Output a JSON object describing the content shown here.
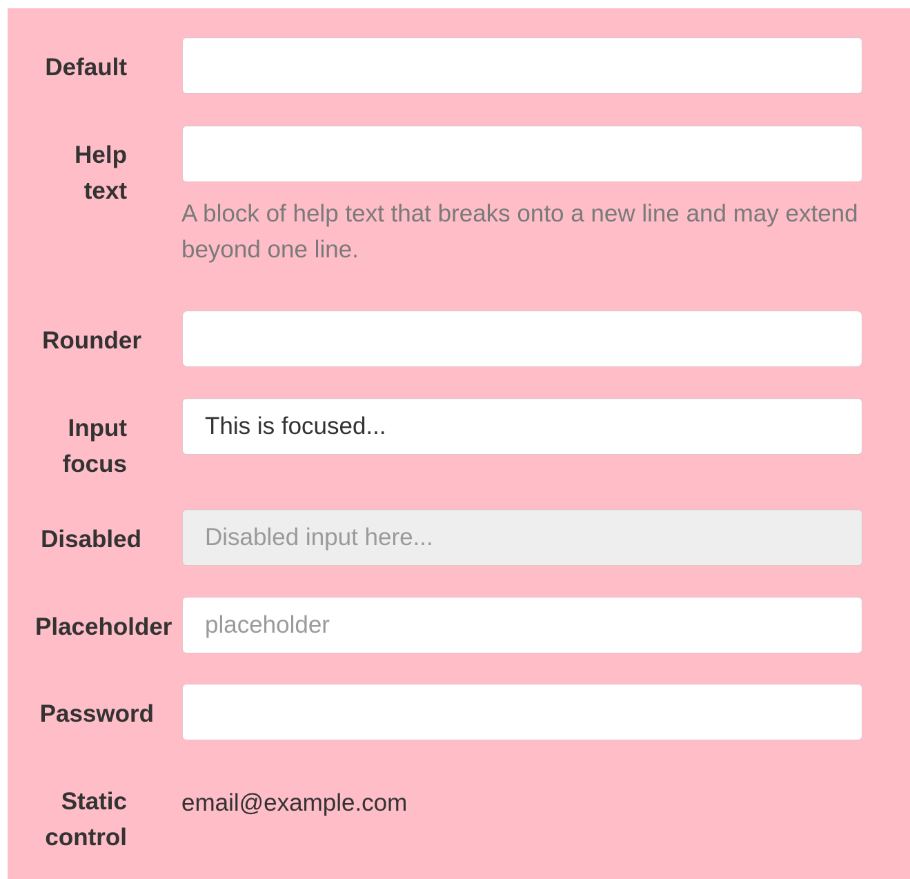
{
  "form": {
    "default": {
      "label": "Default",
      "value": ""
    },
    "help_text": {
      "label_line1": "Help",
      "label_line2": "text",
      "value": "",
      "help": "A block of help text that breaks onto a new line and may extend beyond one line."
    },
    "rounder": {
      "label": "Rounder",
      "value": ""
    },
    "input_focus": {
      "label_line1": "Input",
      "label_line2": "focus",
      "value": "This is focused..."
    },
    "disabled": {
      "label": "Disabled",
      "placeholder": "Disabled input here..."
    },
    "placeholder": {
      "label": "Placeholder",
      "placeholder": "placeholder"
    },
    "password": {
      "label": "Password",
      "value": ""
    },
    "static_control": {
      "label_line1": "Static",
      "label_line2": "control",
      "value": "email@example.com"
    }
  },
  "colors": {
    "background": "#ffbdc7",
    "input_background": "#ffffff",
    "disabled_background": "#eeeeee",
    "label_text": "#333333",
    "help_text": "#7a7a7a"
  }
}
